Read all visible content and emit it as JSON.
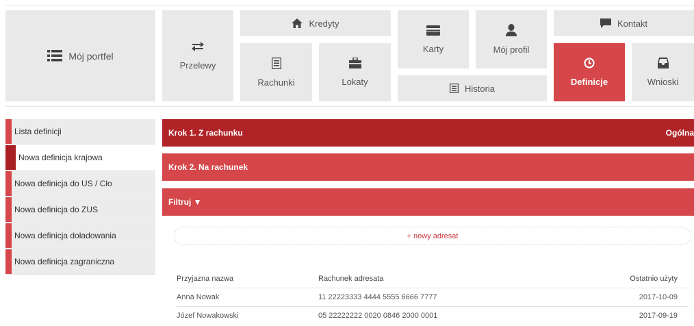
{
  "nav": {
    "portfolio": "Mój portfel",
    "transfers": "Przelewy",
    "credits": "Kredyty",
    "accounts": "Rachunki",
    "deposits": "Lokaty",
    "cards": "Karty",
    "profile": "Mój profil",
    "history": "Historia",
    "contact": "Kontakt",
    "definitions": "Definicje",
    "applications": "Wnioski"
  },
  "sidebar": {
    "items": [
      {
        "label": "Lista definicji"
      },
      {
        "label": "Nowa definicja krajowa"
      },
      {
        "label": "Nowa definicja do US / Cło"
      },
      {
        "label": "Nowa definicja do ZUS"
      },
      {
        "label": "Nowa definicja doładowania"
      },
      {
        "label": "Nowa definicja zagraniczna"
      }
    ],
    "active_index": 1
  },
  "steps": {
    "step1": "Krok 1. Z rachunku",
    "step1_right": "Ogólna",
    "step2": "Krok 2. Na rachunek",
    "filter": "Filtruj ▼"
  },
  "new_recipient": "+ nowy adresat",
  "table": {
    "headers": [
      "Przyjazna nazwa",
      "Rachunek adresata",
      "Ostatnio użyty"
    ],
    "rows": [
      [
        "Anna Nowak",
        "11 22223333 4444 5555 6666 7777",
        "2017-10-09"
      ],
      [
        "Józef Nowakowski",
        "05 22222222 0020 0846 2000 0001",
        "2017-09-19"
      ]
    ]
  },
  "colors": {
    "accent": "#d5474a",
    "accent_dark": "#b02428",
    "tile_bg": "#e9e9e9"
  }
}
